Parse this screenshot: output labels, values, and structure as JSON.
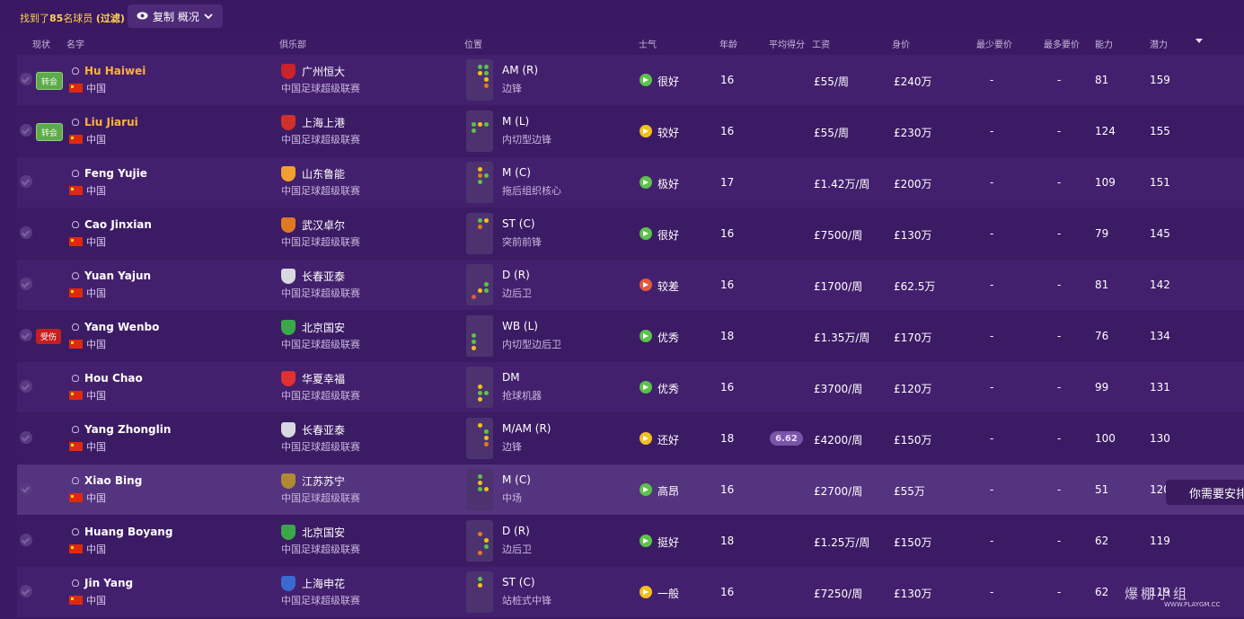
{
  "header": {
    "found_prefix": "找到了",
    "found_count": "85",
    "found_suffix": "名球员",
    "filter_label": "(过滤)",
    "view_label": "复制 概况"
  },
  "columns": [
    "现状",
    "名字",
    "俱乐部",
    "位置",
    "士气",
    "年龄",
    "平均得分",
    "工资",
    "身价",
    "最少要价",
    "最多要价",
    "能力",
    "潜力"
  ],
  "colors": {
    "background": "#3b1a63",
    "accent": "#ffb13b",
    "transfer": "#5fa94c",
    "injury": "#c4201f"
  },
  "players": [
    {
      "status": "转会",
      "status_type": "transfer",
      "name": "Hu Haiwei",
      "name_color": "gold",
      "nationality": "中国",
      "club": "广州恒大",
      "crest": "#c9232c",
      "league": "中国足球超级联赛",
      "position": "AM (R)",
      "role": "边锋",
      "morale": "很好",
      "morale_color": "#5cc24a",
      "age": "16",
      "avg": "",
      "wage": "£55/周",
      "value": "£240万",
      "min": "-",
      "max": "-",
      "ca": "81",
      "pa": "159"
    },
    {
      "status": "转会",
      "status_type": "transfer",
      "name": "Liu Jiarui",
      "name_color": "gold",
      "nationality": "中国",
      "club": "上海上港",
      "crest": "#d0302a",
      "league": "中国足球超级联赛",
      "position": "M (L)",
      "role": "内切型边锋",
      "morale": "较好",
      "morale_color": "#f2c01c",
      "age": "16",
      "avg": "",
      "wage": "£55/周",
      "value": "£230万",
      "min": "-",
      "max": "-",
      "ca": "124",
      "pa": "155"
    },
    {
      "status": "",
      "status_type": "",
      "name": "Feng Yujie",
      "name_color": "white",
      "nationality": "中国",
      "club": "山东鲁能",
      "crest": "#f0a030",
      "league": "中国足球超级联赛",
      "position": "M (C)",
      "role": "拖后组织核心",
      "morale": "极好",
      "morale_color": "#5cc24a",
      "age": "17",
      "avg": "",
      "wage": "£1.42万/周",
      "value": "£200万",
      "min": "-",
      "max": "-",
      "ca": "109",
      "pa": "151"
    },
    {
      "status": "",
      "status_type": "",
      "name": "Cao Jinxian",
      "name_color": "white",
      "nationality": "中国",
      "club": "武汉卓尔",
      "crest": "#e07a20",
      "league": "中国足球超级联赛",
      "position": "ST (C)",
      "role": "突前前锋",
      "morale": "很好",
      "morale_color": "#5cc24a",
      "age": "16",
      "avg": "",
      "wage": "£7500/周",
      "value": "£130万",
      "min": "-",
      "max": "-",
      "ca": "79",
      "pa": "145"
    },
    {
      "status": "",
      "status_type": "",
      "name": "Yuan Yajun",
      "name_color": "white",
      "nationality": "中国",
      "club": "长春亚泰",
      "crest": "#d8d8e0",
      "league": "中国足球超级联赛",
      "position": "D (R)",
      "role": "边后卫",
      "morale": "较差",
      "morale_color": "#e05a40",
      "age": "16",
      "avg": "",
      "wage": "£1700/周",
      "value": "£62.5万",
      "min": "-",
      "max": "-",
      "ca": "81",
      "pa": "142"
    },
    {
      "status": "受伤",
      "status_type": "injury",
      "name": "Yang Wenbo",
      "name_color": "white",
      "nationality": "中国",
      "club": "北京国安",
      "crest": "#3aa84a",
      "league": "中国足球超级联赛",
      "position": "WB (L)",
      "role": "内切型边后卫",
      "morale": "优秀",
      "morale_color": "#5cc24a",
      "age": "18",
      "avg": "",
      "wage": "£1.35万/周",
      "value": "£170万",
      "min": "-",
      "max": "-",
      "ca": "76",
      "pa": "134"
    },
    {
      "status": "",
      "status_type": "",
      "name": "Hou Chao",
      "name_color": "white",
      "nationality": "中国",
      "club": "华夏幸福",
      "crest": "#e03030",
      "league": "中国足球超级联赛",
      "position": "DM",
      "role": "抢球机器",
      "morale": "优秀",
      "morale_color": "#5cc24a",
      "age": "16",
      "avg": "",
      "wage": "£3700/周",
      "value": "£120万",
      "min": "-",
      "max": "-",
      "ca": "99",
      "pa": "131"
    },
    {
      "status": "",
      "status_type": "",
      "name": "Yang Zhonglin",
      "name_color": "white",
      "nationality": "中国",
      "club": "长春亚泰",
      "crest": "#d8d8e0",
      "league": "中国足球超级联赛",
      "position": "M/AM (R)",
      "role": "边锋",
      "morale": "还好",
      "morale_color": "#f2c01c",
      "age": "18",
      "avg": "6.62",
      "wage": "£4200/周",
      "value": "£150万",
      "min": "-",
      "max": "-",
      "ca": "100",
      "pa": "130"
    },
    {
      "status": "",
      "status_type": "",
      "name": "Xiao Bing",
      "name_color": "white",
      "nationality": "中国",
      "club": "江苏苏宁",
      "crest": "#b08a30",
      "league": "中国足球超级联赛",
      "position": "M (C)",
      "role": "中场",
      "morale": "高昂",
      "morale_color": "#5cc24a",
      "age": "16",
      "avg": "",
      "wage": "£2700/周",
      "value": "£55万",
      "min": "-",
      "max": "-",
      "ca": "51",
      "pa": "120"
    },
    {
      "status": "",
      "status_type": "",
      "name": "Huang Boyang",
      "name_color": "white",
      "nationality": "中国",
      "club": "北京国安",
      "crest": "#3aa84a",
      "league": "中国足球超级联赛",
      "position": "D (R)",
      "role": "边后卫",
      "morale": "挺好",
      "morale_color": "#5cc24a",
      "age": "18",
      "avg": "",
      "wage": "£1.25万/周",
      "value": "£150万",
      "min": "-",
      "max": "-",
      "ca": "62",
      "pa": "119"
    },
    {
      "status": "",
      "status_type": "",
      "name": "Jin Yang",
      "name_color": "white",
      "nationality": "中国",
      "club": "上海申花",
      "crest": "#3a6ad0",
      "league": "中国足球超级联赛",
      "position": "ST (C)",
      "role": "站桩式中锋",
      "morale": "一般",
      "morale_color": "#f2c01c",
      "age": "16",
      "avg": "",
      "wage": "£7250/周",
      "value": "£130万",
      "min": "-",
      "max": "-",
      "ca": "62",
      "pa": "119"
    }
  ],
  "tooltip": "你需要安排",
  "watermark": {
    "title": "爆棚小组",
    "url": "WWW.PLAYGM.CC"
  }
}
